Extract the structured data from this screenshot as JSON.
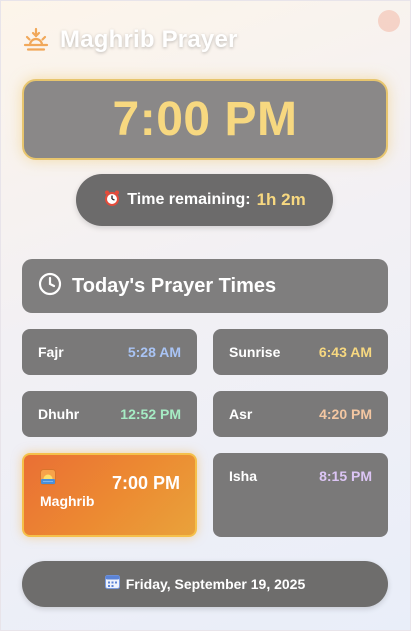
{
  "header": {
    "title": "Maghrib Prayer",
    "icon": "sunset-icon"
  },
  "current_time": "7:00 PM",
  "remaining": {
    "label": "Time remaining:",
    "value": "1h 2m",
    "icon": "alarm-clock-icon"
  },
  "prayer_section": {
    "title": "Today's Prayer Times",
    "icon": "clock-icon"
  },
  "prayers": [
    {
      "name": "Fajr",
      "time": "5:28 AM",
      "color": "#a9c4f5"
    },
    {
      "name": "Sunrise",
      "time": "6:43 AM",
      "color": "#f7d880"
    },
    {
      "name": "Dhuhr",
      "time": "12:52 PM",
      "color": "#a6ecc4"
    },
    {
      "name": "Asr",
      "time": "4:20 PM",
      "color": "#f4c7a2"
    },
    {
      "name": "Maghrib",
      "time": "7:00 PM",
      "color": "#ffffff",
      "active": true
    },
    {
      "name": "Isha",
      "time": "8:15 PM",
      "color": "#dcc5f5"
    }
  ],
  "date": {
    "text": "Friday, September 19, 2025",
    "icon": "calendar-icon"
  },
  "colors": {
    "accent": "#f7d880",
    "active_bg": "#ec8b32",
    "card_bg": "#7a7979"
  }
}
